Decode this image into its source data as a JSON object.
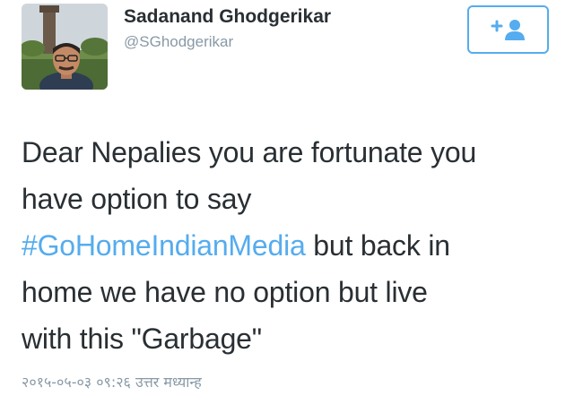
{
  "user": {
    "display_name": "Sadanand Ghodgerikar",
    "handle": "@SGhodgerikar",
    "avatar_icon": "profile-photo"
  },
  "follow_button": {
    "icon": "add-person-icon",
    "accent": "#55acee"
  },
  "tweet": {
    "line1": "Dear Nepalies you are fortunate you",
    "line2": "have option to say",
    "hashtag": "#GoHomeIndianMedia",
    "line3_rest": " but back in",
    "line4": "home we have no option but live",
    "line5": "with this \"Garbage\""
  },
  "timestamp": "२०१५-०५-०३ ०९:२६ उत्तर मध्यान्ह",
  "colors": {
    "text": "#292f33",
    "secondary": "#8899a6",
    "link": "#55acee"
  }
}
